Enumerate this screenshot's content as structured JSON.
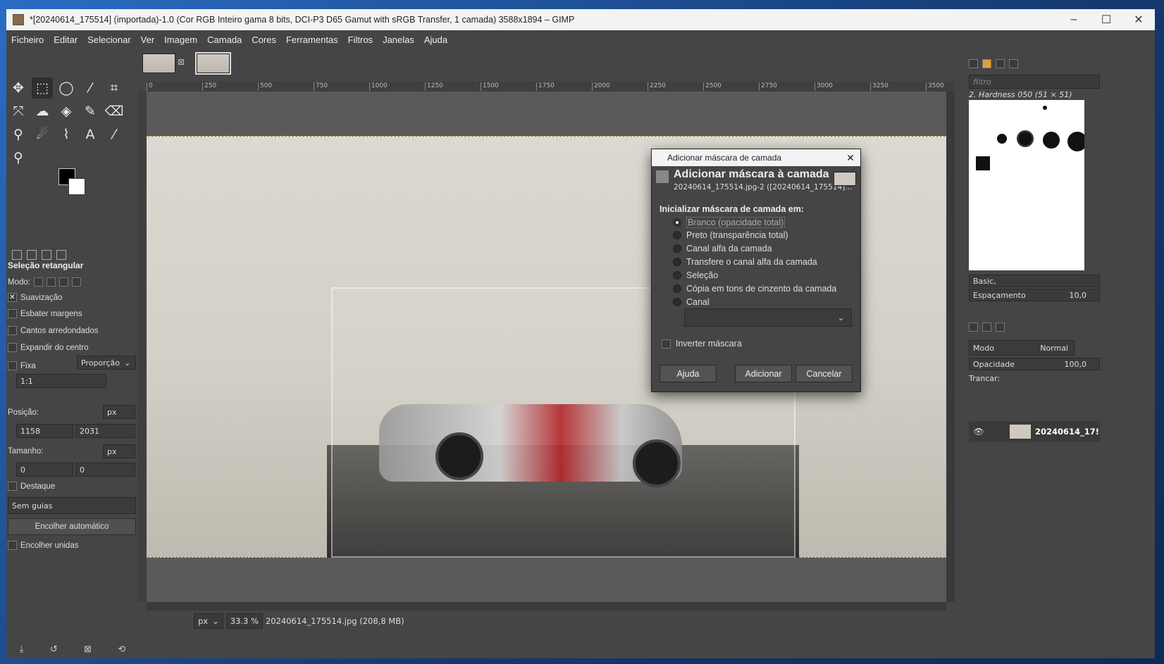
{
  "window": {
    "title": "*[20240614_175514] (importada)-1.0 (Cor RGB Inteiro gama 8 bits, DCI-P3 D65 Gamut with sRGB Transfer, 1 camada) 3588x1894 – GIMP",
    "controls": {
      "minimize": "–",
      "maximize": "☐",
      "close": "✕"
    }
  },
  "menu": [
    "Ficheiro",
    "Editar",
    "Selecionar",
    "Ver",
    "Imagem",
    "Camada",
    "Cores",
    "Ferramentas",
    "Filtros",
    "Janelas",
    "Ajuda"
  ],
  "tool_options": {
    "title": "Seleção retangular",
    "mode_label": "Modo:",
    "antialias": "Suavização",
    "feather": "Esbater margens",
    "rounded": "Cantos arredondados",
    "expand_center": "Expandir do centro",
    "fixed": "Fixa",
    "fixed_mode": "Proporção",
    "ratio": "1:1",
    "position_label": "Posição:",
    "position_unit": "px",
    "pos_x": "1158",
    "pos_y": "2031",
    "size_label": "Tamanho:",
    "size_unit": "px",
    "size_w": "0",
    "size_h": "0",
    "highlight": "Destaque",
    "guides": "Sem guias",
    "auto_shrink": "Encolher automático",
    "shrink_merged": "Encolher unidas"
  },
  "ruler": {
    "ticks": [
      "0",
      "250",
      "500",
      "750",
      "1000",
      "1250",
      "1500",
      "1750",
      "2000",
      "2250",
      "2500",
      "2750",
      "3000",
      "3250",
      "3500"
    ]
  },
  "status": {
    "unit": "px",
    "zoom": "33.3 %",
    "file": "20240614_175514.jpg (208,8 MB)"
  },
  "brushes": {
    "filter_placeholder": "filtro",
    "selected": "2. Hardness 050 (51 × 51)",
    "tag": "Basic,",
    "spacing_label": "Espaçamento",
    "spacing_value": "10,0"
  },
  "layers": {
    "mode_label": "Modo",
    "mode_value": "Normal",
    "opacity_label": "Opacidade",
    "opacity_value": "100,0",
    "lock_label": "Trancar:",
    "layer_name": "20240614_17!"
  },
  "dialog": {
    "window_title": "Adicionar máscara de camada",
    "heading": "Adicionar máscara à camada",
    "subtitle": "20240614_175514.jpg-2 ([20240614_175514]...",
    "section": "Inicializar máscara de camada em:",
    "options": [
      "Branco (opacidade total)",
      "Preto (transparência total)",
      "Canal alfa da camada",
      "Transfere o canal alfa da camada",
      "Seleção",
      "Cópia em tons de cinzento da camada",
      "Canal"
    ],
    "selected_option": 0,
    "invert": "Inverter máscara",
    "buttons": {
      "help": "Ajuda",
      "add": "Adicionar",
      "cancel": "Cancelar"
    }
  }
}
